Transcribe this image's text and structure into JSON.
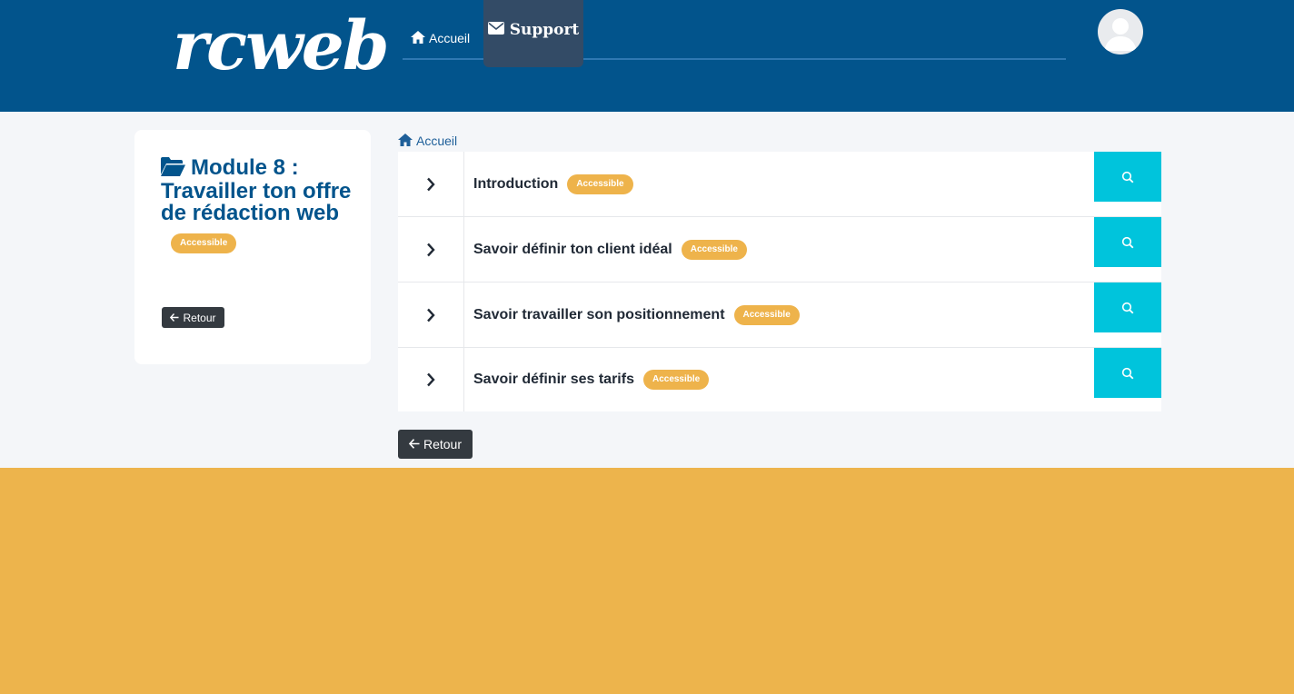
{
  "header": {
    "logo_text": "rcweb",
    "nav": {
      "home_label": "Accueil",
      "support_label": "Support"
    }
  },
  "sidebar": {
    "module_title": "Module 8 : Travailler ton offre de rédaction web",
    "badge": "Accessible",
    "back_label": "Retour"
  },
  "breadcrumb": {
    "home_label": "Accueil"
  },
  "lessons": [
    {
      "title": "Introduction",
      "badge": "Accessible"
    },
    {
      "title": "Savoir définir ton client idéal",
      "badge": "Accessible"
    },
    {
      "title": "Savoir travailler son positionnement",
      "badge": "Accessible"
    },
    {
      "title": "Savoir définir ses tarifs",
      "badge": "Accessible"
    }
  ],
  "main": {
    "back_label": "Retour"
  },
  "colors": {
    "header_bg": "#02548c",
    "accent_badge": "#eeb34b",
    "search_button": "#00c4dc",
    "footer_bg": "#edb44c",
    "dark_button": "#343a40"
  },
  "icons": {
    "home": "home-icon",
    "support": "envelope-icon",
    "folder": "folder-open-icon",
    "chevron": "chevron-right-icon",
    "search": "search-icon",
    "back": "arrow-left-icon",
    "avatar": "user-avatar-icon"
  }
}
